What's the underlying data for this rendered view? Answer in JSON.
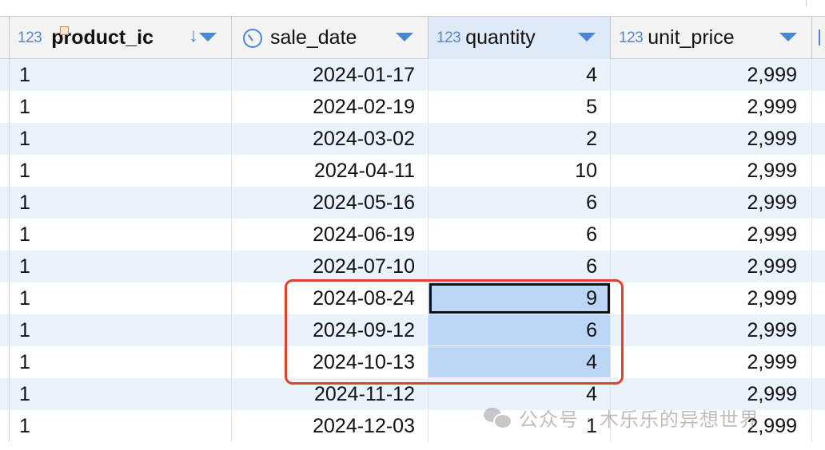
{
  "columns": [
    {
      "type": "123",
      "name": "product_id",
      "display_name": "product_ic"
    },
    {
      "type": "",
      "name": "sale_date"
    },
    {
      "type": "123",
      "name": "quantity"
    },
    {
      "type": "123",
      "name": "unit_price"
    }
  ],
  "rows": [
    {
      "product_id": "1",
      "sale_date": "2024-01-17",
      "quantity": "4",
      "unit_price": "2,999"
    },
    {
      "product_id": "1",
      "sale_date": "2024-02-19",
      "quantity": "5",
      "unit_price": "2,999"
    },
    {
      "product_id": "1",
      "sale_date": "2024-03-02",
      "quantity": "2",
      "unit_price": "2,999"
    },
    {
      "product_id": "1",
      "sale_date": "2024-04-11",
      "quantity": "10",
      "unit_price": "2,999"
    },
    {
      "product_id": "1",
      "sale_date": "2024-05-16",
      "quantity": "6",
      "unit_price": "2,999"
    },
    {
      "product_id": "1",
      "sale_date": "2024-06-19",
      "quantity": "6",
      "unit_price": "2,999"
    },
    {
      "product_id": "1",
      "sale_date": "2024-07-10",
      "quantity": "6",
      "unit_price": "2,999"
    },
    {
      "product_id": "1",
      "sale_date": "2024-08-24",
      "quantity": "9",
      "unit_price": "2,999"
    },
    {
      "product_id": "1",
      "sale_date": "2024-09-12",
      "quantity": "6",
      "unit_price": "2,999"
    },
    {
      "product_id": "1",
      "sale_date": "2024-10-13",
      "quantity": "4",
      "unit_price": "2,999"
    },
    {
      "product_id": "1",
      "sale_date": "2024-11-12",
      "quantity": "4",
      "unit_price": "2,999"
    },
    {
      "product_id": "1",
      "sale_date": "2024-12-03",
      "quantity": "1",
      "unit_price": "2,999"
    }
  ],
  "selection": {
    "column": "quantity",
    "selected_rows": [
      7,
      8,
      9
    ],
    "focused_row": 7
  },
  "icons": {
    "type_badge": "numeric-type-icon",
    "date_type": "clock-icon",
    "primary_key": "primary-key-icon",
    "sort": "sort-descending-icon",
    "dropdown": "chevron-down-icon"
  },
  "colors": {
    "accent": "#4a86d4",
    "row_alt": "#eaf2fc",
    "selection": "#bcd6f5",
    "annotation": "#e2422d"
  },
  "watermark": {
    "text": "公众号 · 木乐乐的异想世界"
  }
}
